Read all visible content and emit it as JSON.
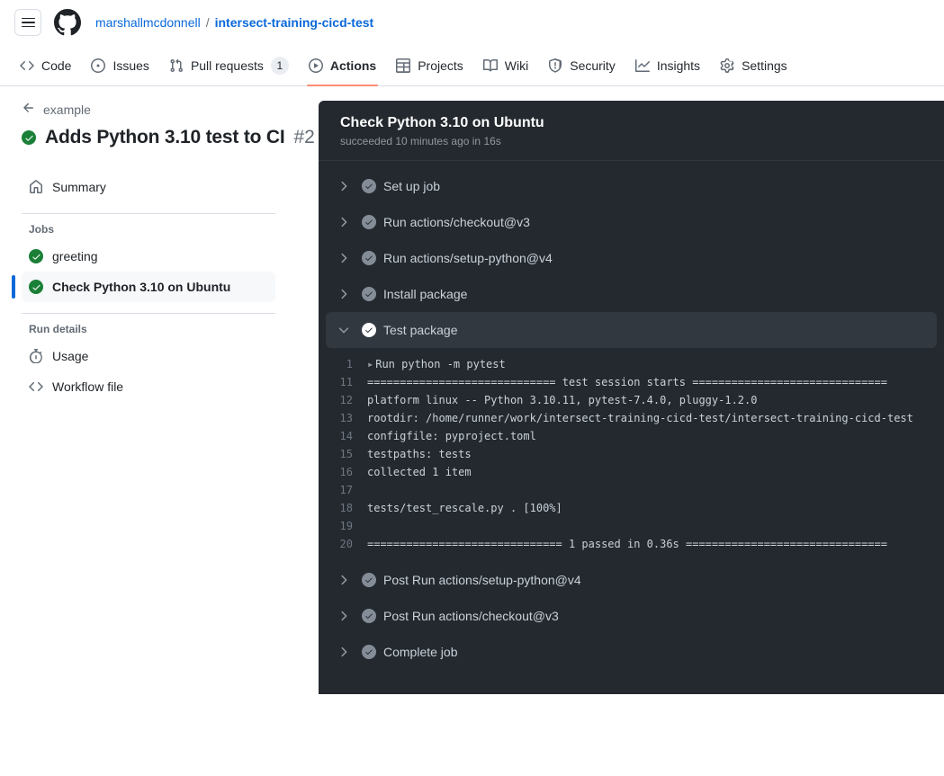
{
  "header": {
    "menu_icon": "hamburger-icon",
    "logo_icon": "github-logo-icon",
    "owner": "marshallmcdonnell",
    "separator": "/",
    "repo": "intersect-training-cicd-test"
  },
  "repo_nav": {
    "items": [
      {
        "label": "Code",
        "icon": "code-icon",
        "active": false
      },
      {
        "label": "Issues",
        "icon": "issue-opened-icon",
        "active": false
      },
      {
        "label": "Pull requests",
        "icon": "git-pull-request-icon",
        "active": false,
        "counter": "1"
      },
      {
        "label": "Actions",
        "icon": "play-icon",
        "active": true
      },
      {
        "label": "Projects",
        "icon": "table-icon",
        "active": false
      },
      {
        "label": "Wiki",
        "icon": "book-icon",
        "active": false
      },
      {
        "label": "Security",
        "icon": "shield-icon",
        "active": false
      },
      {
        "label": "Insights",
        "icon": "graph-icon",
        "active": false
      },
      {
        "label": "Settings",
        "icon": "gear-icon",
        "active": false
      }
    ]
  },
  "run": {
    "back_label": "example",
    "back_icon": "arrow-left-icon",
    "status_icon": "check-circle-green-icon",
    "title": "Adds Python 3.10 test to CI",
    "number": "#2"
  },
  "sidebar": {
    "summary": {
      "label": "Summary",
      "icon": "home-icon"
    },
    "jobs_heading": "Jobs",
    "jobs": [
      {
        "label": "greeting",
        "icon": "check-circle-green-icon",
        "selected": false
      },
      {
        "label": "Check Python 3.10 on Ubuntu",
        "icon": "check-circle-green-icon",
        "selected": true
      }
    ],
    "run_details_heading": "Run details",
    "details": [
      {
        "label": "Usage",
        "icon": "stopwatch-icon"
      },
      {
        "label": "Workflow file",
        "icon": "file-code-icon"
      }
    ]
  },
  "logs": {
    "title": "Check Python 3.10 on Ubuntu",
    "subtitle": "succeeded 10 minutes ago in 16s",
    "steps_before": [
      {
        "label": "Set up job",
        "status": "success",
        "expanded": false
      },
      {
        "label": "Run actions/checkout@v3",
        "status": "success",
        "expanded": false
      },
      {
        "label": "Run actions/setup-python@v4",
        "status": "success",
        "expanded": false
      },
      {
        "label": "Install package",
        "status": "success",
        "expanded": false
      }
    ],
    "expanded_step": {
      "label": "Test package",
      "status": "success",
      "expanded": true
    },
    "lines": [
      {
        "num": "1",
        "marker": "▸",
        "text": "Run python -m pytest"
      },
      {
        "num": "11",
        "marker": "",
        "text": "============================= test session starts =============================="
      },
      {
        "num": "12",
        "marker": "",
        "text": "platform linux -- Python 3.10.11, pytest-7.4.0, pluggy-1.2.0"
      },
      {
        "num": "13",
        "marker": "",
        "text": "rootdir: /home/runner/work/intersect-training-cicd-test/intersect-training-cicd-test"
      },
      {
        "num": "14",
        "marker": "",
        "text": "configfile: pyproject.toml"
      },
      {
        "num": "15",
        "marker": "",
        "text": "testpaths: tests"
      },
      {
        "num": "16",
        "marker": "",
        "text": "collected 1 item"
      },
      {
        "num": "17",
        "marker": "",
        "text": ""
      },
      {
        "num": "18",
        "marker": "",
        "text": "tests/test_rescale.py .                                                  [100%]"
      },
      {
        "num": "19",
        "marker": "",
        "text": ""
      },
      {
        "num": "20",
        "marker": "",
        "text": "============================== 1 passed in 0.36s ==============================="
      }
    ],
    "steps_after": [
      {
        "label": "Post Run actions/setup-python@v4",
        "status": "success",
        "expanded": false
      },
      {
        "label": "Post Run actions/checkout@v3",
        "status": "success",
        "expanded": false
      },
      {
        "label": "Complete job",
        "status": "success",
        "expanded": false
      }
    ]
  },
  "colors": {
    "accent_tab_underline": "#fd8c73",
    "link": "#0969da",
    "success_green": "#1a7f37",
    "panel_bg": "#24292f",
    "panel_row_expanded": "#32383f",
    "sidebar_selected_bar": "#0969da"
  }
}
